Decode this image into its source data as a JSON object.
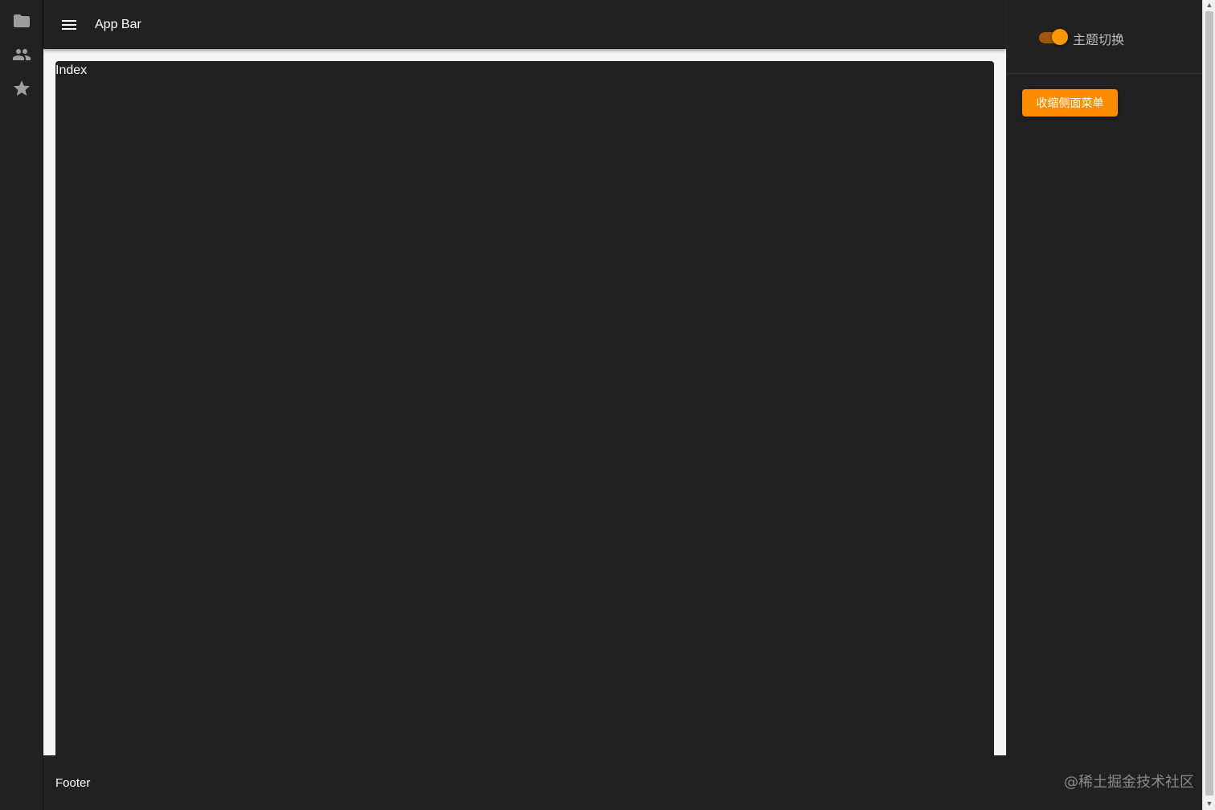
{
  "rail": {
    "items": [
      {
        "icon": "folder-icon"
      },
      {
        "icon": "people-icon"
      },
      {
        "icon": "star-icon"
      }
    ]
  },
  "appbar": {
    "menu_icon": "hamburger-menu-icon",
    "title": "App Bar"
  },
  "main": {
    "title": "Index"
  },
  "drawer": {
    "toggle_label": "主题切换",
    "toggle_on": true,
    "collapse_button_label": "收缩侧面菜单"
  },
  "footer": {
    "text": "Footer",
    "watermark": "@稀土掘金技术社区"
  },
  "colors": {
    "surface": "#212121",
    "accent": "#ff8c00",
    "page_background": "#f5f5f5"
  }
}
